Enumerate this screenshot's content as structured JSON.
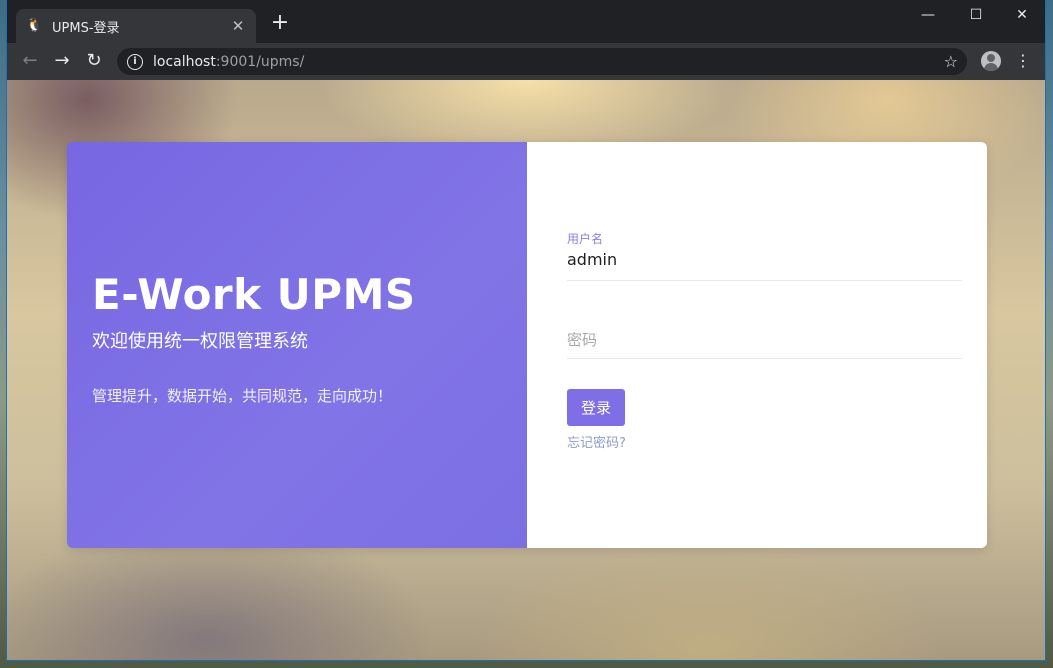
{
  "browser": {
    "tab_title": "UPMS-登录",
    "tab_close": "✕",
    "new_tab": "+",
    "url_host": "localhost",
    "url_path": ":9001/upms/",
    "window_controls": {
      "minimize": "—",
      "maximize": "☐",
      "close": "✕"
    },
    "icons": {
      "back": "←",
      "forward": "→",
      "reload": "↻",
      "info": "i",
      "star": "☆",
      "menu": "⋮"
    }
  },
  "intro": {
    "brand": "E-Work UPMS",
    "welcome": "欢迎使用统一权限管理系统",
    "slogan": "管理提升，数据开始，共同规范，走向成功！"
  },
  "login": {
    "username_label": "用户名",
    "username_value": "admin",
    "password_placeholder": "密码",
    "submit_label": "登录",
    "forgot_label": "忘记密码?"
  },
  "colors": {
    "accent": "#7f6fe6",
    "panel_gradient_start": "#7767e2",
    "link": "#8e9ccd"
  }
}
